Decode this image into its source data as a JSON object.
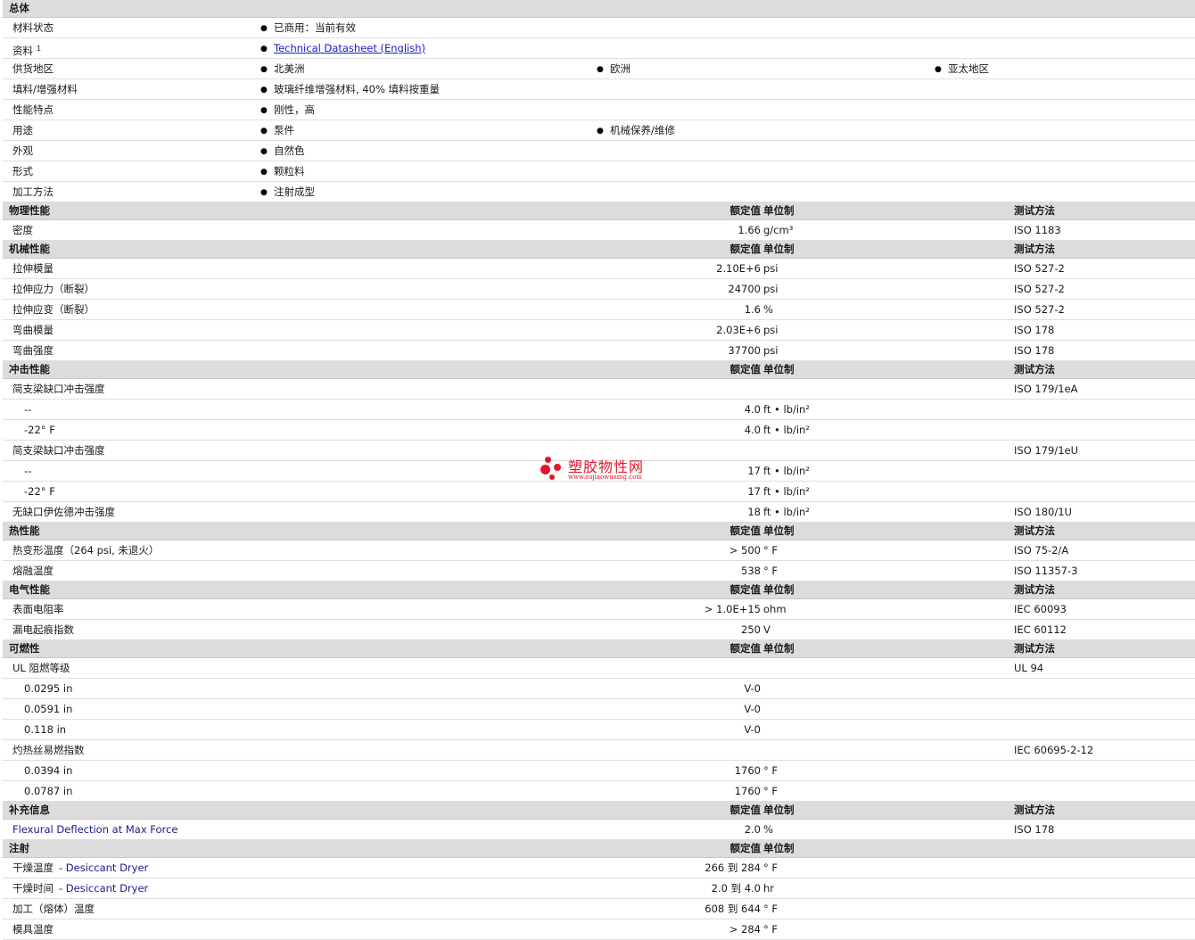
{
  "general": {
    "title": "总体",
    "rows": [
      {
        "label": "材料状态",
        "items": [
          "已商用：当前有效"
        ]
      },
      {
        "label": "资料",
        "sup": "1",
        "link": "Technical Datasheet (English)"
      },
      {
        "label": "供货地区",
        "items": [
          "北美洲",
          "欧洲",
          "亚太地区"
        ]
      },
      {
        "label": "填料/增强材料",
        "items": [
          "玻璃纤维增强材料, 40% 填料按重量"
        ]
      },
      {
        "label": "性能特点",
        "items": [
          "刚性，高"
        ]
      },
      {
        "label": "用途",
        "items": [
          "泵件",
          "机械保养/维修"
        ]
      },
      {
        "label": "外观",
        "items": [
          "自然色"
        ]
      },
      {
        "label": "形式",
        "items": [
          "颗粒料"
        ]
      },
      {
        "label": "加工方法",
        "items": [
          "注射成型"
        ]
      }
    ]
  },
  "col_headers": {
    "value": "额定值",
    "unit": "单位制",
    "method": "测试方法"
  },
  "physical": {
    "title": "物理性能",
    "rows": [
      {
        "name": "密度",
        "value": "1.66",
        "unit": "g/cm³",
        "method": "ISO 1183"
      }
    ]
  },
  "mechanical": {
    "title": "机械性能",
    "rows": [
      {
        "name": "拉伸模量",
        "value": "2.10E+6",
        "unit": "psi",
        "method": "ISO 527-2"
      },
      {
        "name": "拉伸应力（断裂）",
        "value": "24700",
        "unit": "psi",
        "method": "ISO 527-2"
      },
      {
        "name": "拉伸应变（断裂）",
        "value": "1.6",
        "unit": "%",
        "method": "ISO 527-2"
      },
      {
        "name": "弯曲模量",
        "value": "2.03E+6",
        "unit": "psi",
        "method": "ISO 178"
      },
      {
        "name": "弯曲强度",
        "value": "37700",
        "unit": "psi",
        "method": "ISO 178"
      }
    ]
  },
  "impact": {
    "title": "冲击性能",
    "rows": [
      {
        "name": "简支梁缺口冲击强度",
        "value": "",
        "unit": "",
        "method": "ISO 179/1eA"
      },
      {
        "sub": "--",
        "value": "4.0",
        "unit": "ft • lb/in²",
        "method": ""
      },
      {
        "sub": "-22° F",
        "value": "4.0",
        "unit": "ft • lb/in²",
        "method": ""
      },
      {
        "name": "简支梁缺口冲击强度",
        "value": "",
        "unit": "",
        "method": "ISO 179/1eU"
      },
      {
        "sub": "--",
        "value": "17",
        "unit": "ft • lb/in²",
        "method": ""
      },
      {
        "sub": "-22° F",
        "value": "17",
        "unit": "ft • lb/in²",
        "method": ""
      },
      {
        "name": "无缺口伊佐德冲击强度",
        "value": "18",
        "unit": "ft • lb/in²",
        "method": "ISO 180/1U"
      }
    ]
  },
  "thermal": {
    "title": "热性能",
    "rows": [
      {
        "name": "热变形温度（264 psi, 未退火）",
        "value": "> 500",
        "unit": "° F",
        "method": "ISO 75-2/A"
      },
      {
        "name": "熔融温度",
        "value": "538",
        "unit": "° F",
        "method": "ISO 11357-3"
      }
    ]
  },
  "electrical": {
    "title": "电气性能",
    "rows": [
      {
        "name": "表面电阻率",
        "value": "> 1.0E+15",
        "unit": "ohm",
        "method": "IEC 60093"
      },
      {
        "name": "漏电起痕指数",
        "value": "250",
        "unit": "V",
        "method": "IEC 60112"
      }
    ]
  },
  "flammability": {
    "title": "可燃性",
    "rows": [
      {
        "name": "UL 阻燃等级",
        "value": "",
        "unit": "",
        "method": "UL 94"
      },
      {
        "sub": "0.0295 in",
        "value": "V-0",
        "unit": "",
        "method": ""
      },
      {
        "sub": "0.0591 in",
        "value": "V-0",
        "unit": "",
        "method": ""
      },
      {
        "sub": "0.118 in",
        "value": "V-0",
        "unit": "",
        "method": ""
      },
      {
        "name": "灼热丝易燃指数",
        "value": "",
        "unit": "",
        "method": "IEC 60695-2-12"
      },
      {
        "sub": "0.0394 in",
        "value": "1760",
        "unit": "° F",
        "method": ""
      },
      {
        "sub": "0.0787 in",
        "value": "1760",
        "unit": "° F",
        "method": ""
      }
    ]
  },
  "supplementary": {
    "title": "补充信息",
    "rows": [
      {
        "name": "Flexural Deflection at Max Force",
        "value": "2.0",
        "unit": "%",
        "method": "ISO 178"
      }
    ]
  },
  "injection": {
    "title": "注射",
    "rows": [
      {
        "name": "干燥温度",
        "qual": "- Desiccant Dryer",
        "value": "266 到 284",
        "unit": "° F",
        "method": ""
      },
      {
        "name": "干燥时间",
        "qual": "- Desiccant Dryer",
        "value": "2.0 到 4.0",
        "unit": "hr",
        "method": ""
      },
      {
        "name": "加工（熔体）温度",
        "value": "608 到 644",
        "unit": "° F",
        "method": ""
      },
      {
        "name": "模具温度",
        "value": "> 284",
        "unit": "° F",
        "method": ""
      }
    ]
  },
  "watermark": {
    "title": "塑胶物性网",
    "url": "www.sujiaowuxing.com",
    "color": "#e2162a"
  }
}
